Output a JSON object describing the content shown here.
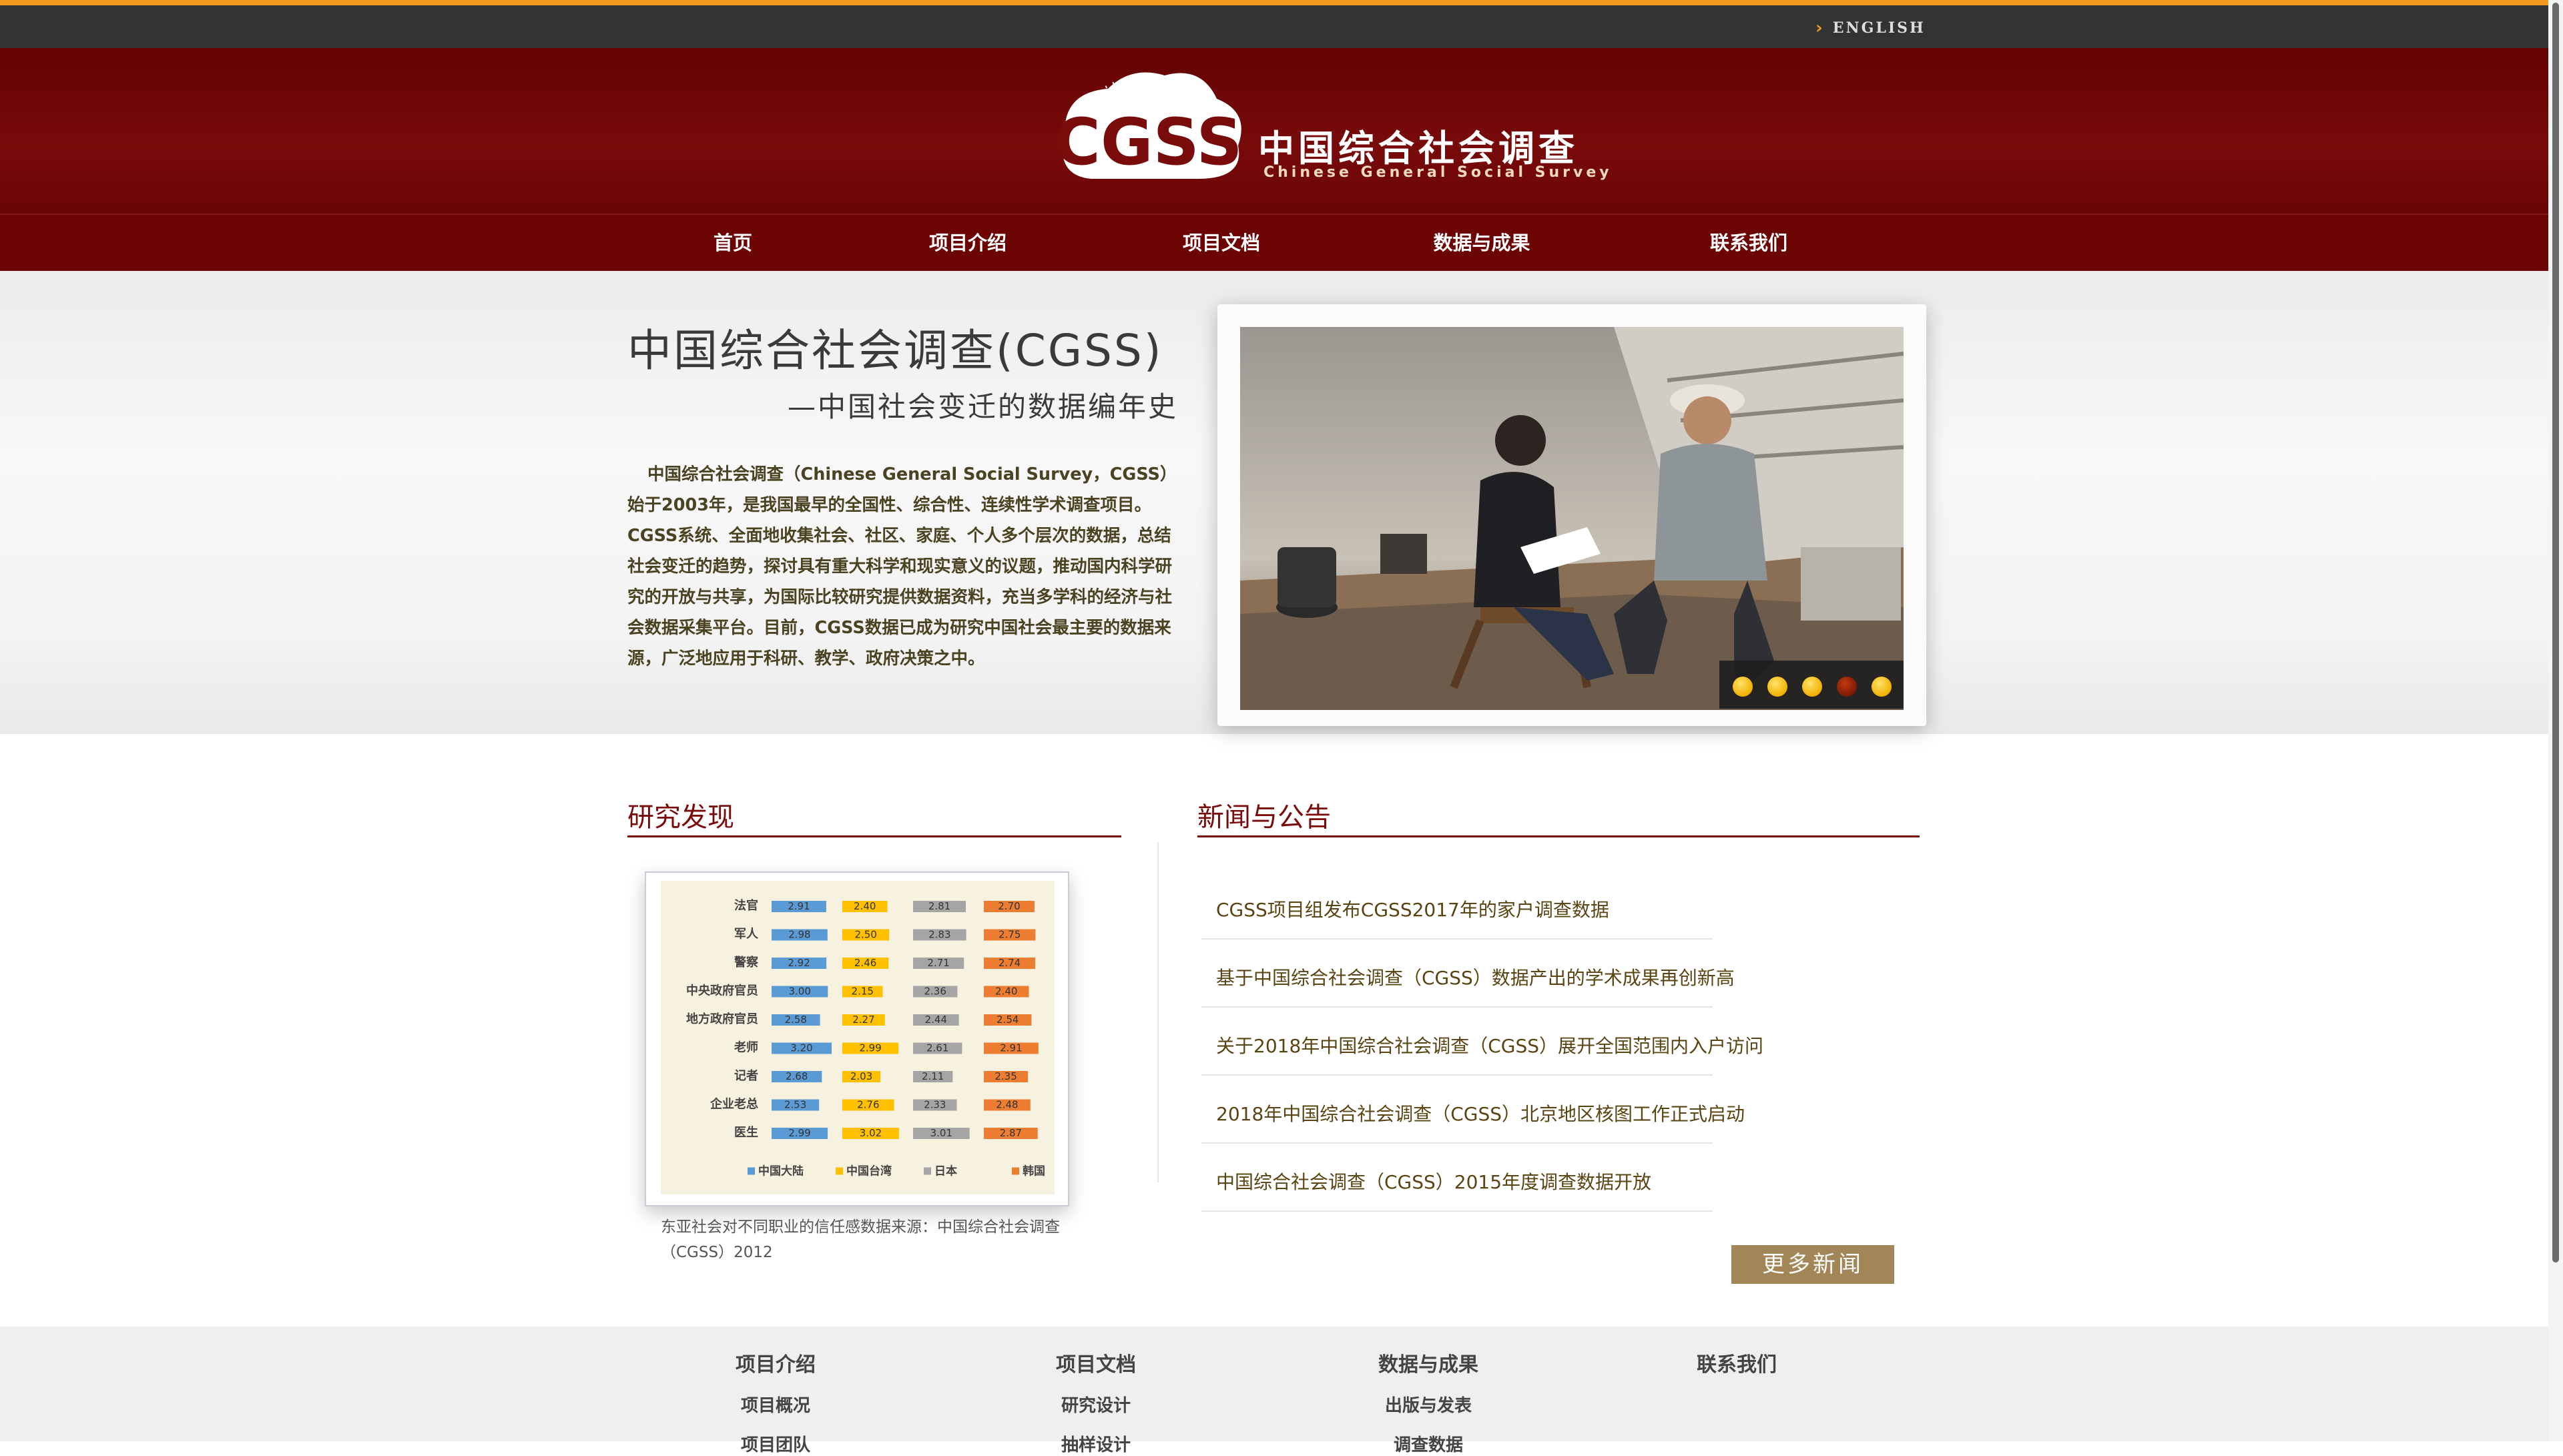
{
  "topbar": {
    "language_link": "ENGLISH"
  },
  "header": {
    "logo_text": "CGSS",
    "logo_cn": "中国综合社会调查",
    "logo_en": "Chinese General Social Survey"
  },
  "nav": {
    "items": [
      "首页",
      "项目介绍",
      "项目文档",
      "数据与成果",
      "联系我们"
    ]
  },
  "hero": {
    "title": "中国综合社会调查(CGSS)",
    "subtitle": "—中国社会变迁的数据编年史",
    "paragraph": "中国综合社会调查（Chinese General Social Survey，CGSS）始于2003年，是我国最早的全国性、综合性、连续性学术调查项目。CGSS系统、全面地收集社会、社区、家庭、个人多个层次的数据，总结社会变迁的趋势，探讨具有重大科学和现实意义的议题，推动国内科学研究的开放与共享，为国际比较研究提供数据资料，充当多学科的经济与社会数据采集平台。目前，CGSS数据已成为研究中国社会最主要的数据来源，广泛地应用于科研、教学、政府决策之中。",
    "slider": {
      "count": 5,
      "active_index": 3
    }
  },
  "research": {
    "title": "研究发现",
    "caption": "东亚社会对不同职业的信任感数据来源：中国综合社会调查（CGSS）2012"
  },
  "chart_data": {
    "type": "bar",
    "categories": [
      "法官",
      "军人",
      "警察",
      "中央政府官员",
      "地方政府官员",
      "老师",
      "记者",
      "企业老总",
      "医生"
    ],
    "series": [
      {
        "name": "中国大陆",
        "color": "#5b9bd5",
        "values": [
          2.91,
          2.98,
          2.92,
          3.0,
          2.58,
          3.2,
          2.68,
          2.53,
          2.99
        ]
      },
      {
        "name": "中国台湾",
        "color": "#ffc000",
        "values": [
          2.4,
          2.5,
          2.46,
          2.15,
          2.27,
          2.99,
          2.03,
          2.76,
          3.02
        ]
      },
      {
        "name": "日本",
        "color": "#a5a5a5",
        "values": [
          2.81,
          2.83,
          2.71,
          2.36,
          2.44,
          2.61,
          2.11,
          2.33,
          3.01
        ]
      },
      {
        "name": "韩国",
        "color": "#ed7d31",
        "values": [
          2.7,
          2.75,
          2.74,
          2.4,
          2.54,
          2.91,
          2.35,
          2.48,
          2.87
        ]
      }
    ]
  },
  "news": {
    "title": "新闻与公告",
    "items": [
      "CGSS项目组发布CGSS2017年的家户调查数据",
      "基于中国综合社会调查（CGSS）数据产出的学术成果再创新高",
      "关于2018年中国综合社会调查（CGSS）展开全国范围内入户访问",
      "2018年中国综合社会调查（CGSS）北京地区核图工作正式启动",
      "中国综合社会调查（CGSS）2015年度调查数据开放"
    ],
    "more_label": "更多新闻"
  },
  "footer": {
    "columns": [
      {
        "title": "项目介绍",
        "links": [
          "项目概况",
          "项目团队"
        ]
      },
      {
        "title": "项目文档",
        "links": [
          "研究设计",
          "抽样设计"
        ]
      },
      {
        "title": "数据与成果",
        "links": [
          "出版与发表",
          "调查数据"
        ]
      },
      {
        "title": "联系我们",
        "links": []
      }
    ]
  },
  "colors": {
    "accent": "#f39a1e",
    "brand_red": "#7a0b0b",
    "button": "#a28658"
  }
}
